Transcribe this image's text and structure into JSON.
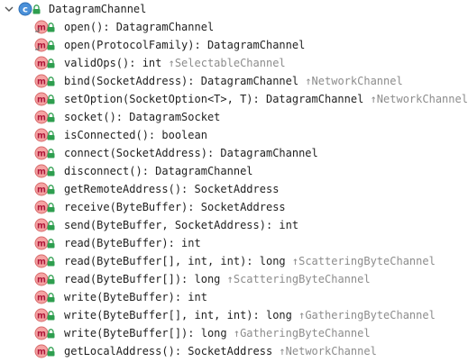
{
  "root": {
    "label": "DatagramChannel"
  },
  "items": [
    {
      "name": "open",
      "signature": "open(): DatagramChannel",
      "inherited": "",
      "static": true
    },
    {
      "name": "open-protocol",
      "signature": "open(ProtocolFamily): DatagramChannel",
      "inherited": "",
      "static": true
    },
    {
      "name": "validOps",
      "signature": "validOps(): int",
      "inherited": "↑SelectableChannel",
      "static": false
    },
    {
      "name": "bind",
      "signature": "bind(SocketAddress): DatagramChannel",
      "inherited": "↑NetworkChannel",
      "static": false
    },
    {
      "name": "setOption",
      "signature": "setOption(SocketOption<T>, T): DatagramChannel",
      "inherited": "↑NetworkChannel",
      "static": false
    },
    {
      "name": "socket",
      "signature": "socket(): DatagramSocket",
      "inherited": "",
      "static": false
    },
    {
      "name": "isConnected",
      "signature": "isConnected(): boolean",
      "inherited": "",
      "static": false
    },
    {
      "name": "connect",
      "signature": "connect(SocketAddress): DatagramChannel",
      "inherited": "",
      "static": false
    },
    {
      "name": "disconnect",
      "signature": "disconnect(): DatagramChannel",
      "inherited": "",
      "static": false
    },
    {
      "name": "getRemoteAddress",
      "signature": "getRemoteAddress(): SocketAddress",
      "inherited": "",
      "static": false
    },
    {
      "name": "receive",
      "signature": "receive(ByteBuffer): SocketAddress",
      "inherited": "",
      "static": false
    },
    {
      "name": "send",
      "signature": "send(ByteBuffer, SocketAddress): int",
      "inherited": "",
      "static": false
    },
    {
      "name": "read",
      "signature": "read(ByteBuffer): int",
      "inherited": "",
      "static": false
    },
    {
      "name": "read-array-offset",
      "signature": "read(ByteBuffer[], int, int): long",
      "inherited": "↑ScatteringByteChannel",
      "static": false
    },
    {
      "name": "read-array",
      "signature": "read(ByteBuffer[]): long",
      "inherited": "↑ScatteringByteChannel",
      "static": false
    },
    {
      "name": "write",
      "signature": "write(ByteBuffer): int",
      "inherited": "",
      "static": false
    },
    {
      "name": "write-array-offset",
      "signature": "write(ByteBuffer[], int, int): long",
      "inherited": "↑GatheringByteChannel",
      "static": false
    },
    {
      "name": "write-array",
      "signature": "write(ByteBuffer[]): long",
      "inherited": "↑GatheringByteChannel",
      "static": false
    },
    {
      "name": "getLocalAddress",
      "signature": "getLocalAddress(): SocketAddress",
      "inherited": "↑NetworkChannel",
      "static": false
    }
  ],
  "icons": {
    "chevron": "chevron-down-icon",
    "class": "class-icon",
    "method": "method-icon",
    "lock": "lock-icon"
  },
  "colors": {
    "class_icon": "#4a90d9",
    "method_icon": "#f28c8c",
    "method_letter": "#c7254e",
    "lock": "#2e9e4f",
    "inherited_text": "#8c8c8c"
  }
}
